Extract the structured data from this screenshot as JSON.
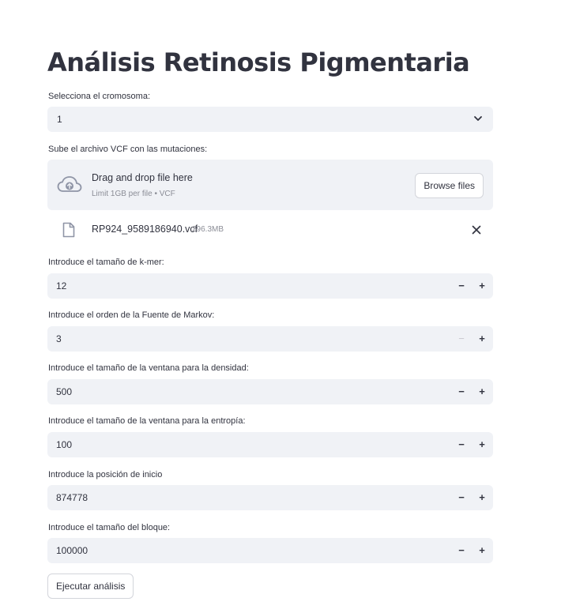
{
  "title": "Análisis Retinosis Pigmentaria",
  "chromosome": {
    "label": "Selecciona el cromosoma:",
    "value": "1"
  },
  "uploader": {
    "label": "Sube el archivo VCF con las mutaciones:",
    "drop_text": "Drag and drop file here",
    "limit_text": "Limit 1GB per file • VCF",
    "browse_label": "Browse files",
    "file": {
      "name": "RP924_9589186940.vcf",
      "size": "296.3MB"
    }
  },
  "inputs": [
    {
      "label": "Introduce el tamaño de k-mer:",
      "value": "12",
      "minus_disabled": false
    },
    {
      "label": "Introduce el orden de la Fuente de Markov:",
      "value": "3",
      "minus_disabled": true
    },
    {
      "label": "Introduce el tamaño de la ventana para la densidad:",
      "value": "500",
      "minus_disabled": false
    },
    {
      "label": "Introduce el tamaño de la ventana para la entropía:",
      "value": "100",
      "minus_disabled": false
    },
    {
      "label": "Introduce la posición de inicio",
      "value": "874778",
      "minus_disabled": false
    },
    {
      "label": "Introduce el tamaño del bloque:",
      "value": "100000",
      "minus_disabled": false
    }
  ],
  "stepper": {
    "minus": "−",
    "plus": "+"
  },
  "run_button": "Ejecutar análisis",
  "icons": {
    "chevron": "chevron-down-icon",
    "upload": "cloud-upload-icon",
    "file": "file-icon",
    "close": "close-icon"
  }
}
